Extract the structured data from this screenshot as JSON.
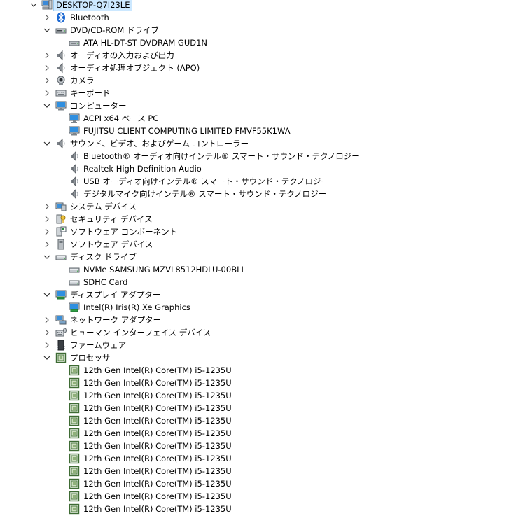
{
  "tree": [
    {
      "level": 0,
      "expand": "open",
      "icon": "computer-root-icon",
      "label": "DESKTOP-Q7I23LE",
      "selected": true
    },
    {
      "level": 1,
      "expand": "closed",
      "icon": "bluetooth-icon",
      "label": "Bluetooth"
    },
    {
      "level": 1,
      "expand": "open",
      "icon": "dvd-drive-icon",
      "label": "DVD/CD-ROM ドライブ"
    },
    {
      "level": 2,
      "expand": "none",
      "icon": "dvd-drive-icon",
      "label": "ATA HL-DT-ST DVDRAM GUD1N"
    },
    {
      "level": 1,
      "expand": "closed",
      "icon": "speaker-icon",
      "label": "オーディオの入力および出力"
    },
    {
      "level": 1,
      "expand": "closed",
      "icon": "speaker-icon",
      "label": "オーディオ処理オブジェクト (APO)"
    },
    {
      "level": 1,
      "expand": "closed",
      "icon": "camera-icon",
      "label": "カメラ"
    },
    {
      "level": 1,
      "expand": "closed",
      "icon": "keyboard-icon",
      "label": "キーボード"
    },
    {
      "level": 1,
      "expand": "open",
      "icon": "monitor-icon",
      "label": "コンピューター"
    },
    {
      "level": 2,
      "expand": "none",
      "icon": "monitor-icon",
      "label": "ACPI x64 ベース PC"
    },
    {
      "level": 2,
      "expand": "none",
      "icon": "monitor-icon",
      "label": "FUJITSU CLIENT COMPUTING LIMITED FMVF55K1WA"
    },
    {
      "level": 1,
      "expand": "open",
      "icon": "speaker-icon",
      "label": "サウンド、ビデオ、およびゲーム コントローラー"
    },
    {
      "level": 2,
      "expand": "none",
      "icon": "speaker-icon",
      "label": "Bluetooth® オーディオ向けインテル® スマート・サウンド・テクノロジー"
    },
    {
      "level": 2,
      "expand": "none",
      "icon": "speaker-icon",
      "label": "Realtek High Definition Audio"
    },
    {
      "level": 2,
      "expand": "none",
      "icon": "speaker-icon",
      "label": "USB オーディオ向けインテル® スマート・サウンド・テクノロジー"
    },
    {
      "level": 2,
      "expand": "none",
      "icon": "speaker-icon",
      "label": "デジタルマイク向けインテル® スマート・サウンド・テクノロジー"
    },
    {
      "level": 1,
      "expand": "closed",
      "icon": "system-devices-icon",
      "label": "システム デバイス"
    },
    {
      "level": 1,
      "expand": "closed",
      "icon": "security-key-icon",
      "label": "セキュリティ デバイス"
    },
    {
      "level": 1,
      "expand": "closed",
      "icon": "software-component-icon",
      "label": "ソフトウェア コンポーネント"
    },
    {
      "level": 1,
      "expand": "closed",
      "icon": "software-device-icon",
      "label": "ソフトウェア デバイス"
    },
    {
      "level": 1,
      "expand": "open",
      "icon": "disk-drive-icon",
      "label": "ディスク ドライブ"
    },
    {
      "level": 2,
      "expand": "none",
      "icon": "disk-drive-icon",
      "label": "NVMe SAMSUNG MZVL8512HDLU-00BLL"
    },
    {
      "level": 2,
      "expand": "none",
      "icon": "disk-drive-icon",
      "label": "SDHC Card"
    },
    {
      "level": 1,
      "expand": "open",
      "icon": "display-adapter-icon",
      "label": "ディスプレイ アダプター"
    },
    {
      "level": 2,
      "expand": "none",
      "icon": "display-adapter-icon",
      "label": "Intel(R) Iris(R) Xe Graphics"
    },
    {
      "level": 1,
      "expand": "closed",
      "icon": "network-adapter-icon",
      "label": "ネットワーク アダプター"
    },
    {
      "level": 1,
      "expand": "closed",
      "icon": "hid-icon",
      "label": "ヒューマン インターフェイス デバイス"
    },
    {
      "level": 1,
      "expand": "closed",
      "icon": "firmware-icon",
      "label": "ファームウェア"
    },
    {
      "level": 1,
      "expand": "open",
      "icon": "processor-icon",
      "label": "プロセッサ"
    },
    {
      "level": 2,
      "expand": "none",
      "icon": "processor-icon",
      "label": "12th Gen Intel(R) Core(TM) i5-1235U"
    },
    {
      "level": 2,
      "expand": "none",
      "icon": "processor-icon",
      "label": "12th Gen Intel(R) Core(TM) i5-1235U"
    },
    {
      "level": 2,
      "expand": "none",
      "icon": "processor-icon",
      "label": "12th Gen Intel(R) Core(TM) i5-1235U"
    },
    {
      "level": 2,
      "expand": "none",
      "icon": "processor-icon",
      "label": "12th Gen Intel(R) Core(TM) i5-1235U"
    },
    {
      "level": 2,
      "expand": "none",
      "icon": "processor-icon",
      "label": "12th Gen Intel(R) Core(TM) i5-1235U"
    },
    {
      "level": 2,
      "expand": "none",
      "icon": "processor-icon",
      "label": "12th Gen Intel(R) Core(TM) i5-1235U"
    },
    {
      "level": 2,
      "expand": "none",
      "icon": "processor-icon",
      "label": "12th Gen Intel(R) Core(TM) i5-1235U"
    },
    {
      "level": 2,
      "expand": "none",
      "icon": "processor-icon",
      "label": "12th Gen Intel(R) Core(TM) i5-1235U"
    },
    {
      "level": 2,
      "expand": "none",
      "icon": "processor-icon",
      "label": "12th Gen Intel(R) Core(TM) i5-1235U"
    },
    {
      "level": 2,
      "expand": "none",
      "icon": "processor-icon",
      "label": "12th Gen Intel(R) Core(TM) i5-1235U"
    },
    {
      "level": 2,
      "expand": "none",
      "icon": "processor-icon",
      "label": "12th Gen Intel(R) Core(TM) i5-1235U"
    },
    {
      "level": 2,
      "expand": "none",
      "icon": "processor-icon",
      "label": "12th Gen Intel(R) Core(TM) i5-1235U"
    }
  ]
}
